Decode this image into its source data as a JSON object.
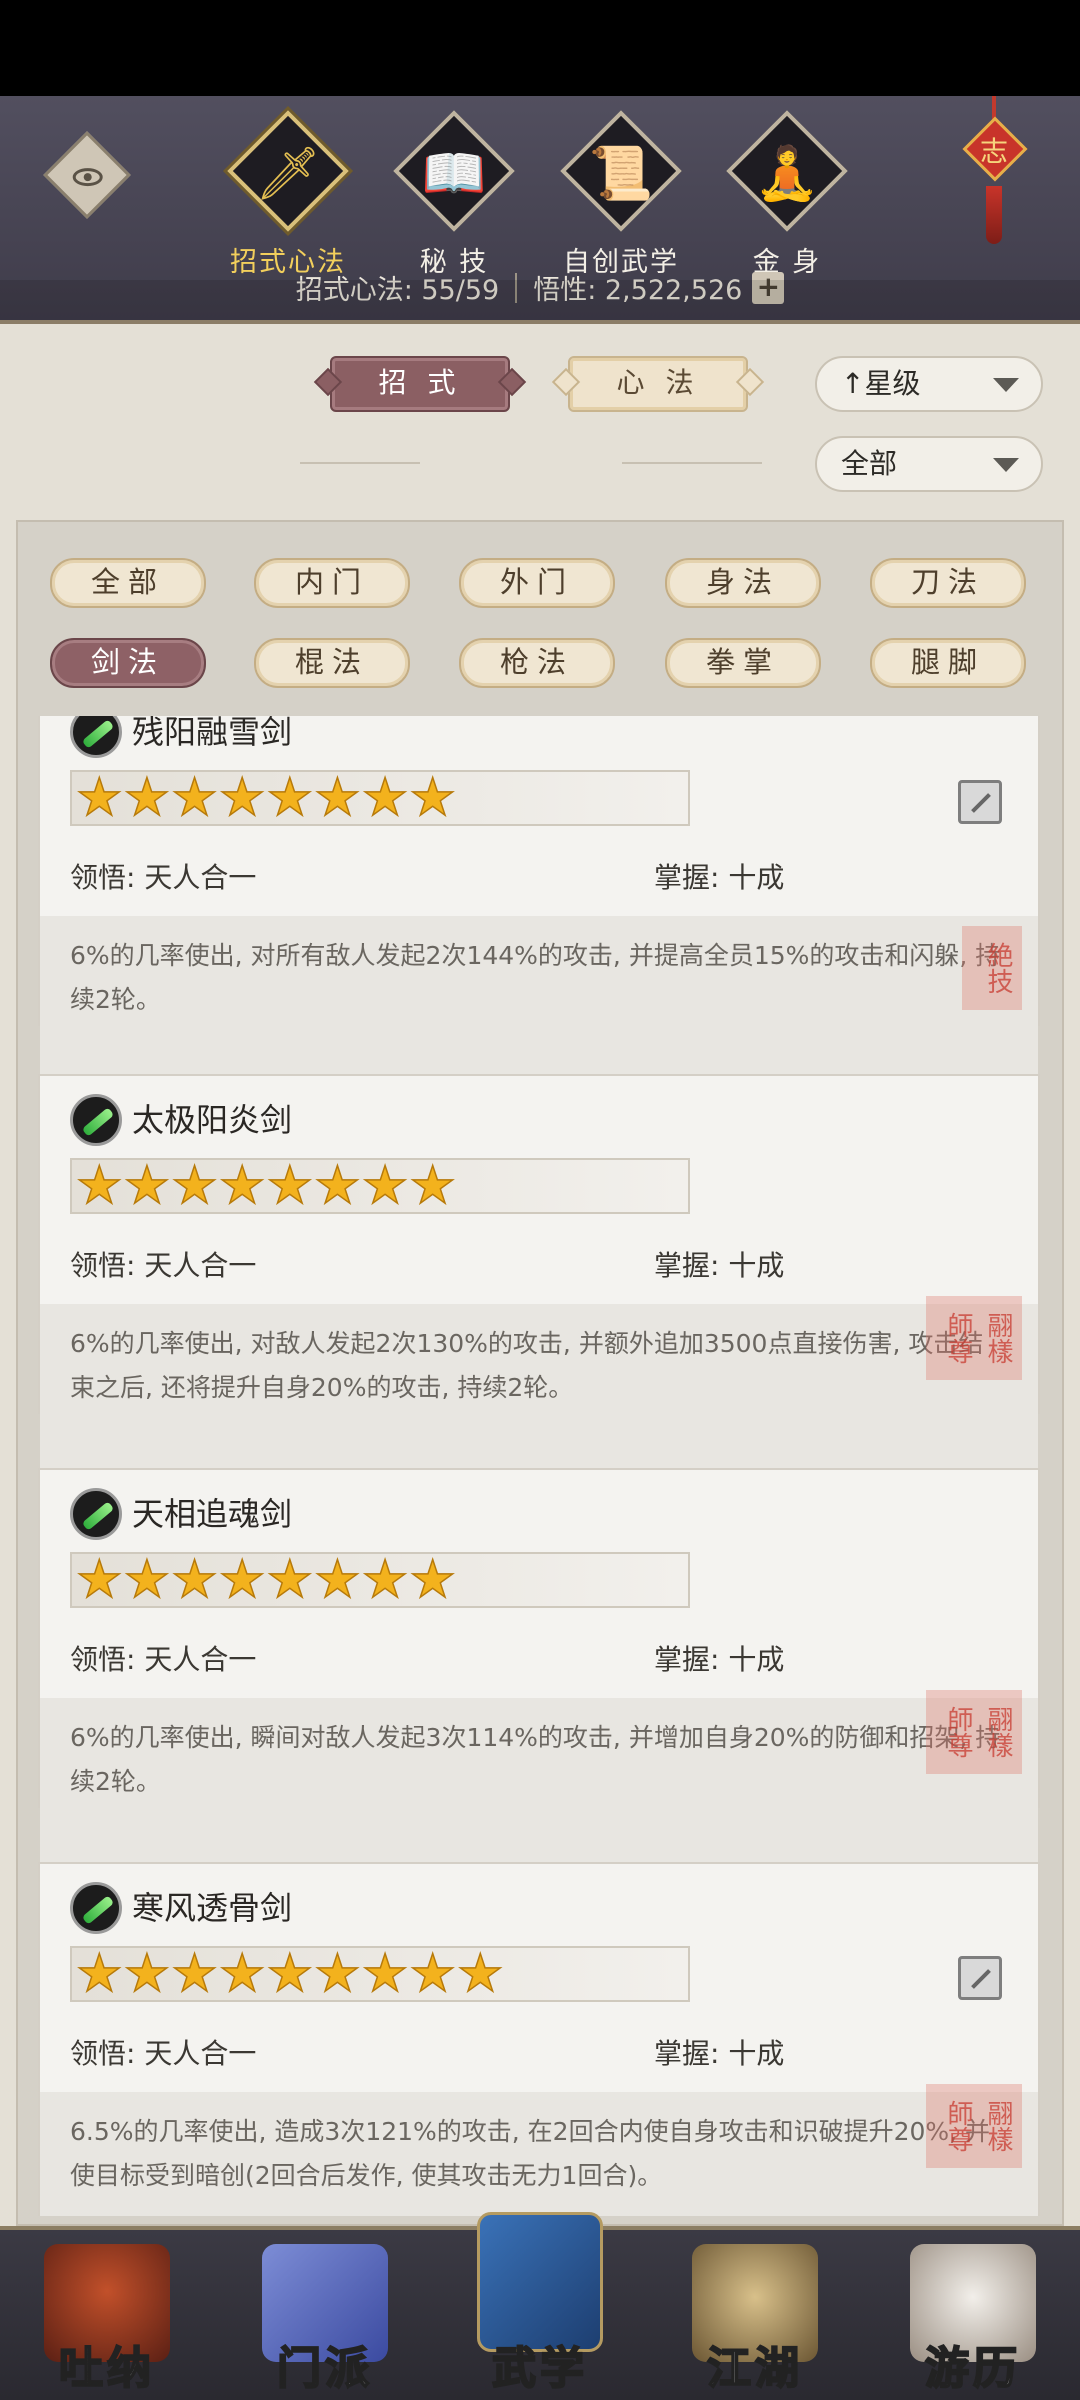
{
  "header": {
    "tabs": [
      {
        "label": "招式心法",
        "glyph": "🗡",
        "icon": "sword-icon"
      },
      {
        "label": "秘 技",
        "glyph": "📖",
        "icon": "book-icon"
      },
      {
        "label": "自创武学",
        "glyph": "📜",
        "icon": "scroll-icon"
      },
      {
        "label": "金 身",
        "glyph": "🧘",
        "icon": "meditation-icon"
      }
    ],
    "knot_char": "志",
    "stats": {
      "skills": "招式心法: 55/59",
      "insight": "悟性: 2,522,526",
      "plus": "+"
    }
  },
  "filters": {
    "mode_active": "招 式",
    "mode_other": "心 法",
    "sort": "↑星级",
    "scope": "全部"
  },
  "categories": [
    {
      "label": "全部"
    },
    {
      "label": "内门"
    },
    {
      "label": "外门"
    },
    {
      "label": "身法"
    },
    {
      "label": "刀法"
    },
    {
      "label": "剑法"
    },
    {
      "label": "棍法"
    },
    {
      "label": "枪法"
    },
    {
      "label": "拳掌"
    },
    {
      "label": "腿脚"
    }
  ],
  "skills": [
    {
      "name": "残阳融雪剑",
      "stars": "★★★★★★★★",
      "star_count": 8,
      "comprehension": "领悟: 天人合一",
      "mastery": "掌握: 十成",
      "desc": "6%的几率使出, 对所有敌人发起2次144%的攻击, 并提高全员15%的攻击和闪躲, 持续2轮。",
      "seal": "絶技"
    },
    {
      "name": "太极阳炎剑",
      "stars": "★★★★★★★★",
      "star_count": 8,
      "comprehension": "领悟: 天人合一",
      "mastery": "掌握: 十成",
      "desc": "6%的几率使出, 对敌人发起2次130%的攻击, 并额外追加3500点直接伤害, 攻击结束之后, 还将提升自身20%的攻击, 持续2轮。",
      "seal": "翮樣師尊"
    },
    {
      "name": "天相追魂剑",
      "stars": "★★★★★★★★",
      "star_count": 8,
      "comprehension": "领悟: 天人合一",
      "mastery": "掌握: 十成",
      "desc": "6%的几率使出, 瞬间对敌人发起3次114%的攻击, 并增加自身20%的防御和招架, 持续2轮。",
      "seal": "翮樣師尊"
    },
    {
      "name": "寒风透骨剑",
      "stars": "★★★★★★★★★",
      "star_count": 9,
      "comprehension": "领悟: 天人合一",
      "mastery": "掌握: 十成",
      "desc": "6.5%的几率使出, 造成3次121%的攻击, 在2回合内使自身攻击和识破提升20%, 并使目标受到暗创(2回合后发作, 使其攻击无力1回合)。",
      "seal": "翮樣師尊"
    }
  ],
  "bottom_nav": [
    {
      "label": "吐纳",
      "icon": "monk-icon"
    },
    {
      "label": "门派",
      "icon": "banner-icon"
    },
    {
      "label": "武学",
      "icon": "manual-icon"
    },
    {
      "label": "江湖",
      "icon": "straw-hat-icon"
    },
    {
      "label": "游历",
      "icon": "horse-icon"
    }
  ]
}
